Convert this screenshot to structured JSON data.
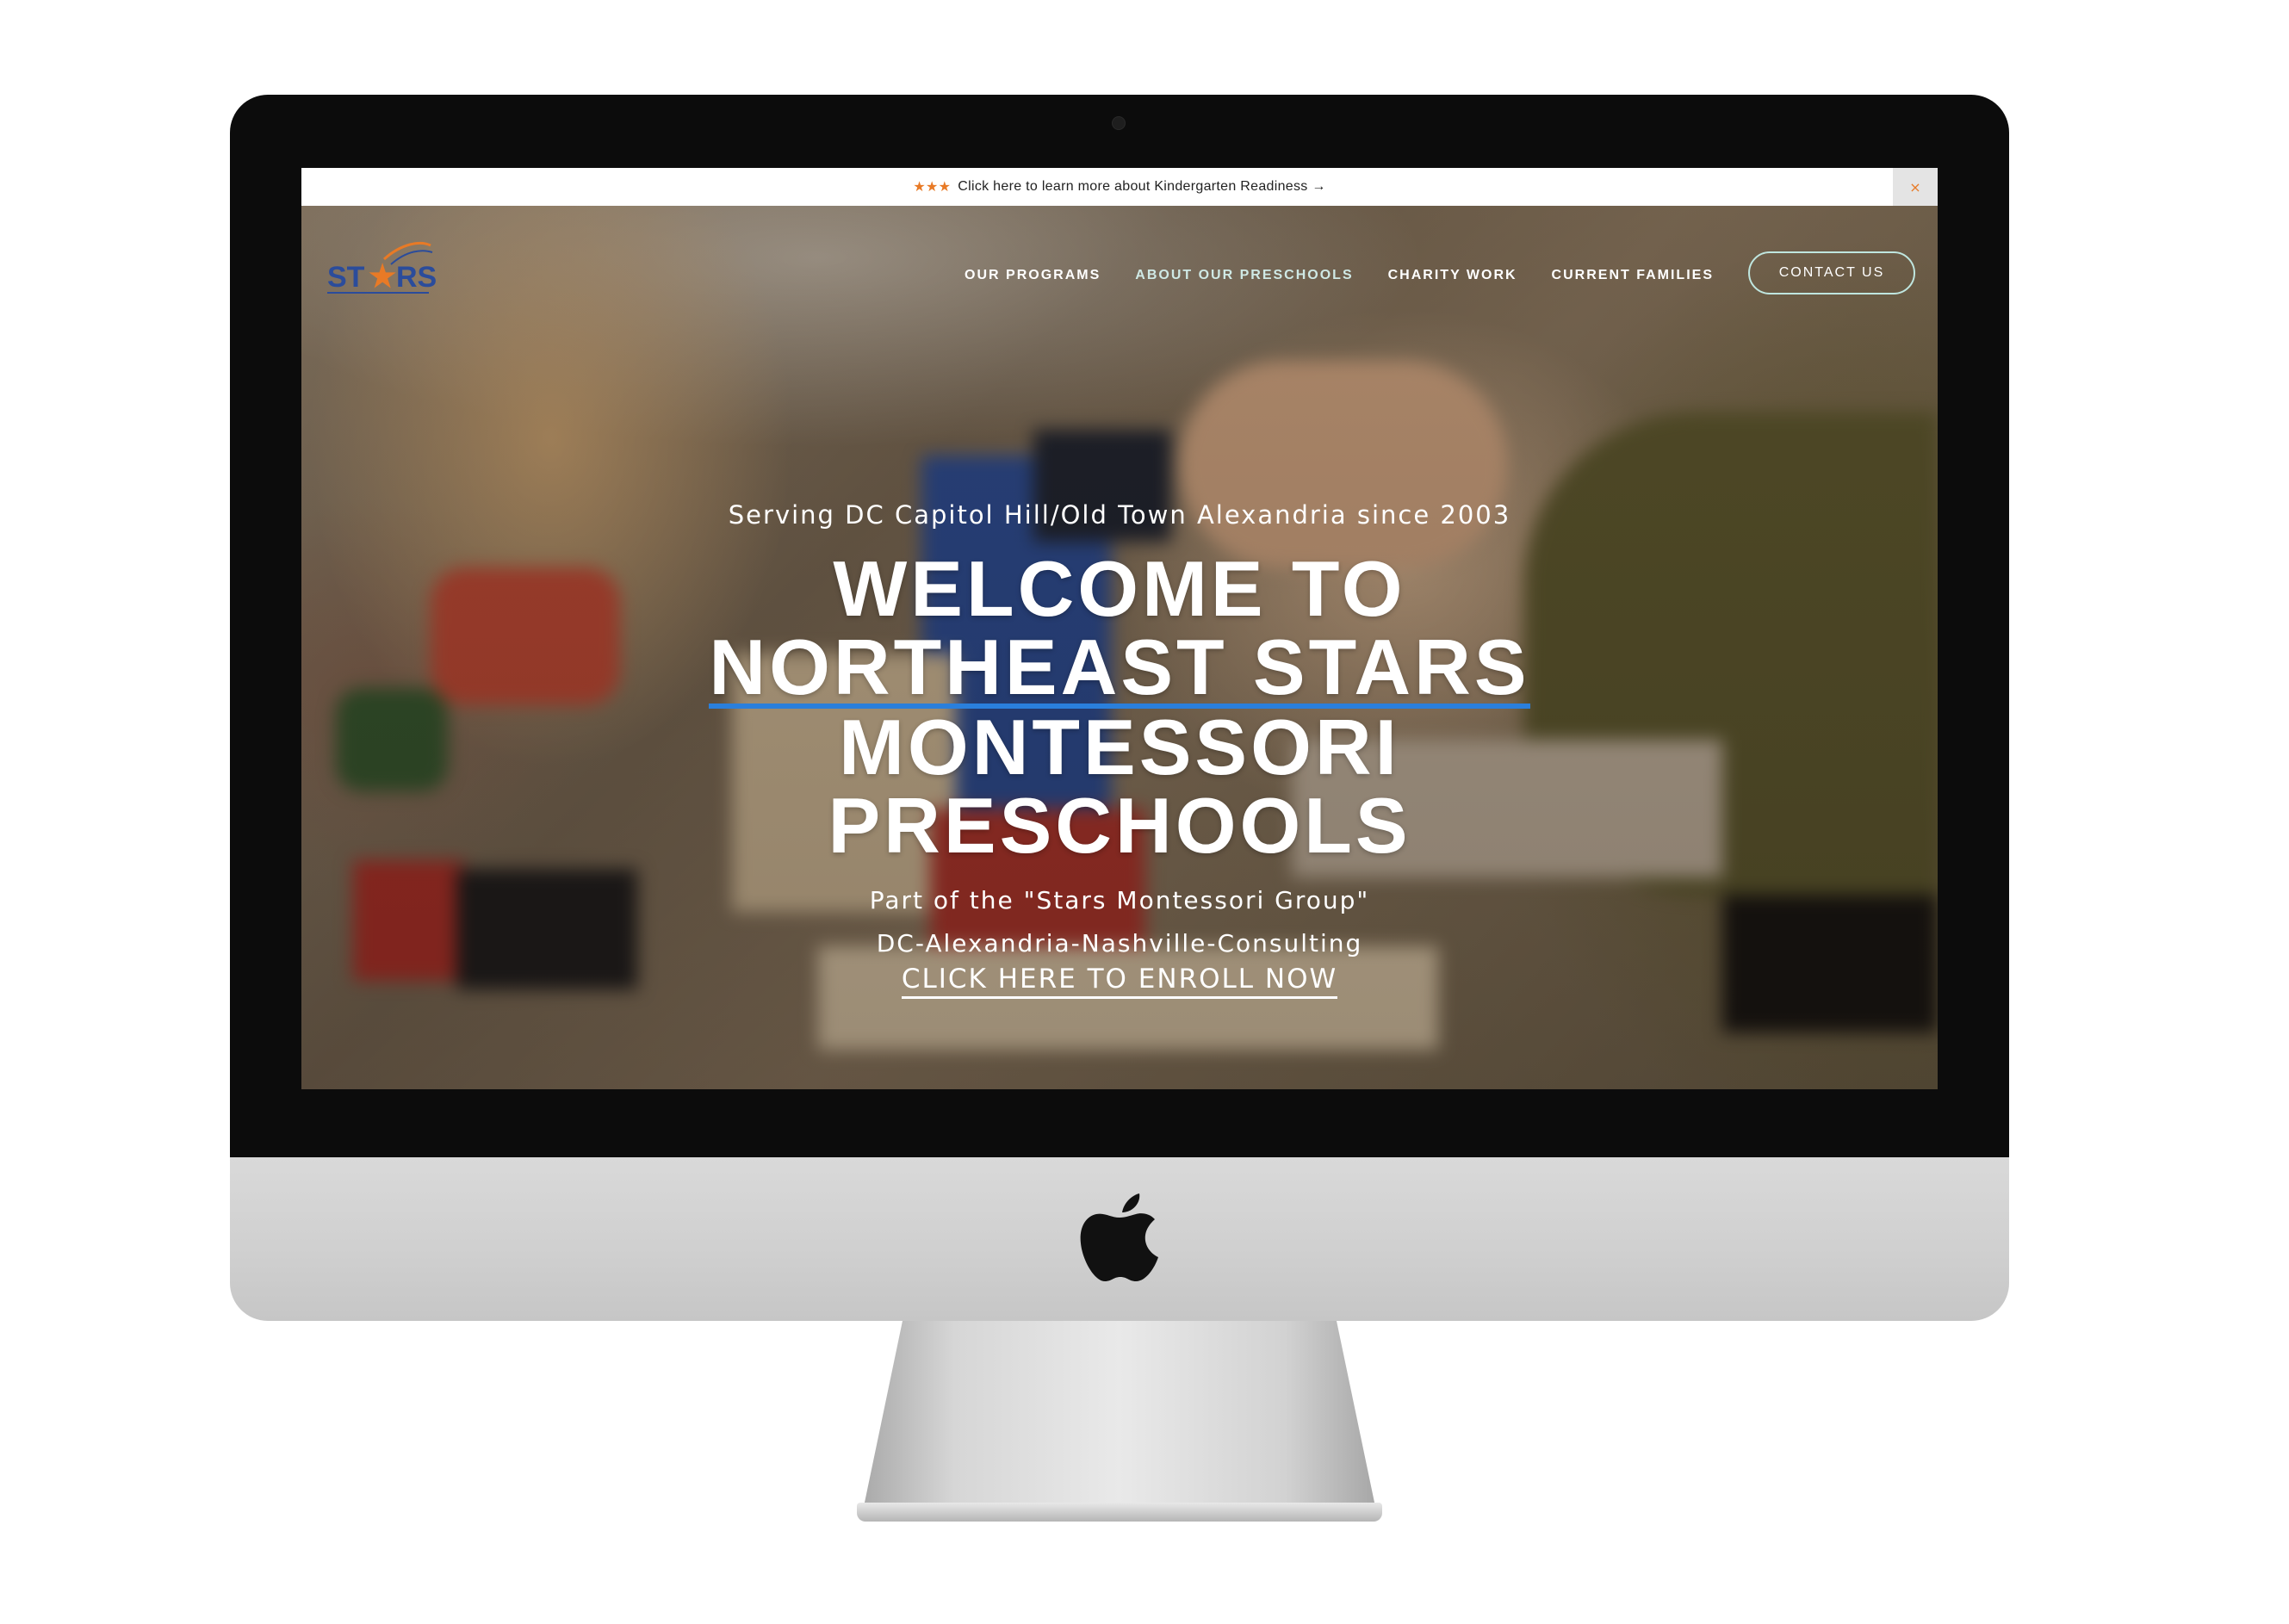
{
  "announcement": {
    "stars": "★★★",
    "text": "Click here to learn more about Kindergarten Readiness →",
    "close": "×"
  },
  "logo": {
    "text": "STARS",
    "star": "★",
    "tagline": "NORTHEAST STARS MONTESSORI"
  },
  "nav": {
    "items": [
      "OUR PROGRAMS",
      "ABOUT OUR PRESCHOOLS",
      "CHARITY WORK",
      "CURRENT FAMILIES"
    ],
    "cta": "CONTACT US"
  },
  "hero": {
    "eyebrow": "Serving DC Capitol Hill/Old Town Alexandria since 2003",
    "headline": [
      "WELCOME TO",
      "NORTHEAST STARS",
      "MONTESSORI",
      "PRESCHOOLS"
    ],
    "sub1": "Part of the \"Stars Montessori Group\"",
    "sub2": "DC-Alexandria-Nashville-Consulting",
    "enroll": "CLICK HERE TO ENROLL NOW"
  },
  "colors": {
    "accent_orange": "#e87a26",
    "underline_blue": "#2a7fdc",
    "logo_blue": "#2b4c9b",
    "button_border": "#bfe6df"
  }
}
